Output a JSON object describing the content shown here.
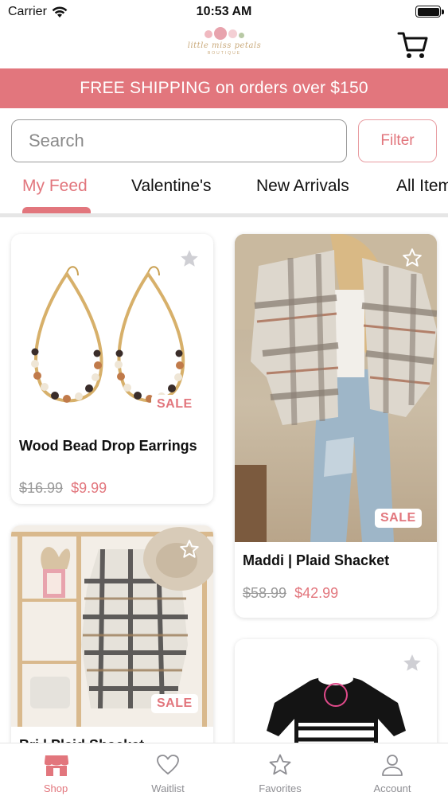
{
  "status_bar": {
    "carrier": "Carrier",
    "time": "10:53 AM"
  },
  "header": {
    "logo_text": "little miss petals",
    "logo_subtext": "BOUTIQUE",
    "cart_icon": "cart-icon"
  },
  "banner": {
    "text": "FREE SHIPPING on orders over $150"
  },
  "search": {
    "placeholder": "Search",
    "filter_label": "Filter"
  },
  "tabs": [
    {
      "label": "My Feed",
      "active": true
    },
    {
      "label": "Valentine's",
      "active": false
    },
    {
      "label": "New Arrivals",
      "active": false
    },
    {
      "label": "All Items",
      "active": false
    }
  ],
  "products": [
    {
      "name": "Wood Bead Drop Earrings",
      "original_price": "$16.99",
      "sale_price": "$9.99",
      "badge": "SALE",
      "favorited": false
    },
    {
      "name": "Maddi | Plaid Shacket",
      "original_price": "$58.99",
      "sale_price": "$42.99",
      "badge": "SALE",
      "favorited": false
    },
    {
      "name": "Bri | Plaid Shacket",
      "badge": "SALE",
      "favorited": false
    },
    {
      "name": "",
      "favorited": false
    }
  ],
  "tabbar": [
    {
      "label": "Shop",
      "icon": "shop-icon",
      "active": true
    },
    {
      "label": "Waitlist",
      "icon": "heart-icon",
      "active": false
    },
    {
      "label": "Favorites",
      "icon": "star-icon",
      "active": false
    },
    {
      "label": "Account",
      "icon": "person-icon",
      "active": false
    }
  ],
  "colors": {
    "accent": "#e2767d",
    "accent_light": "#e89ca1",
    "text": "#111111",
    "muted": "#8e8e93"
  }
}
